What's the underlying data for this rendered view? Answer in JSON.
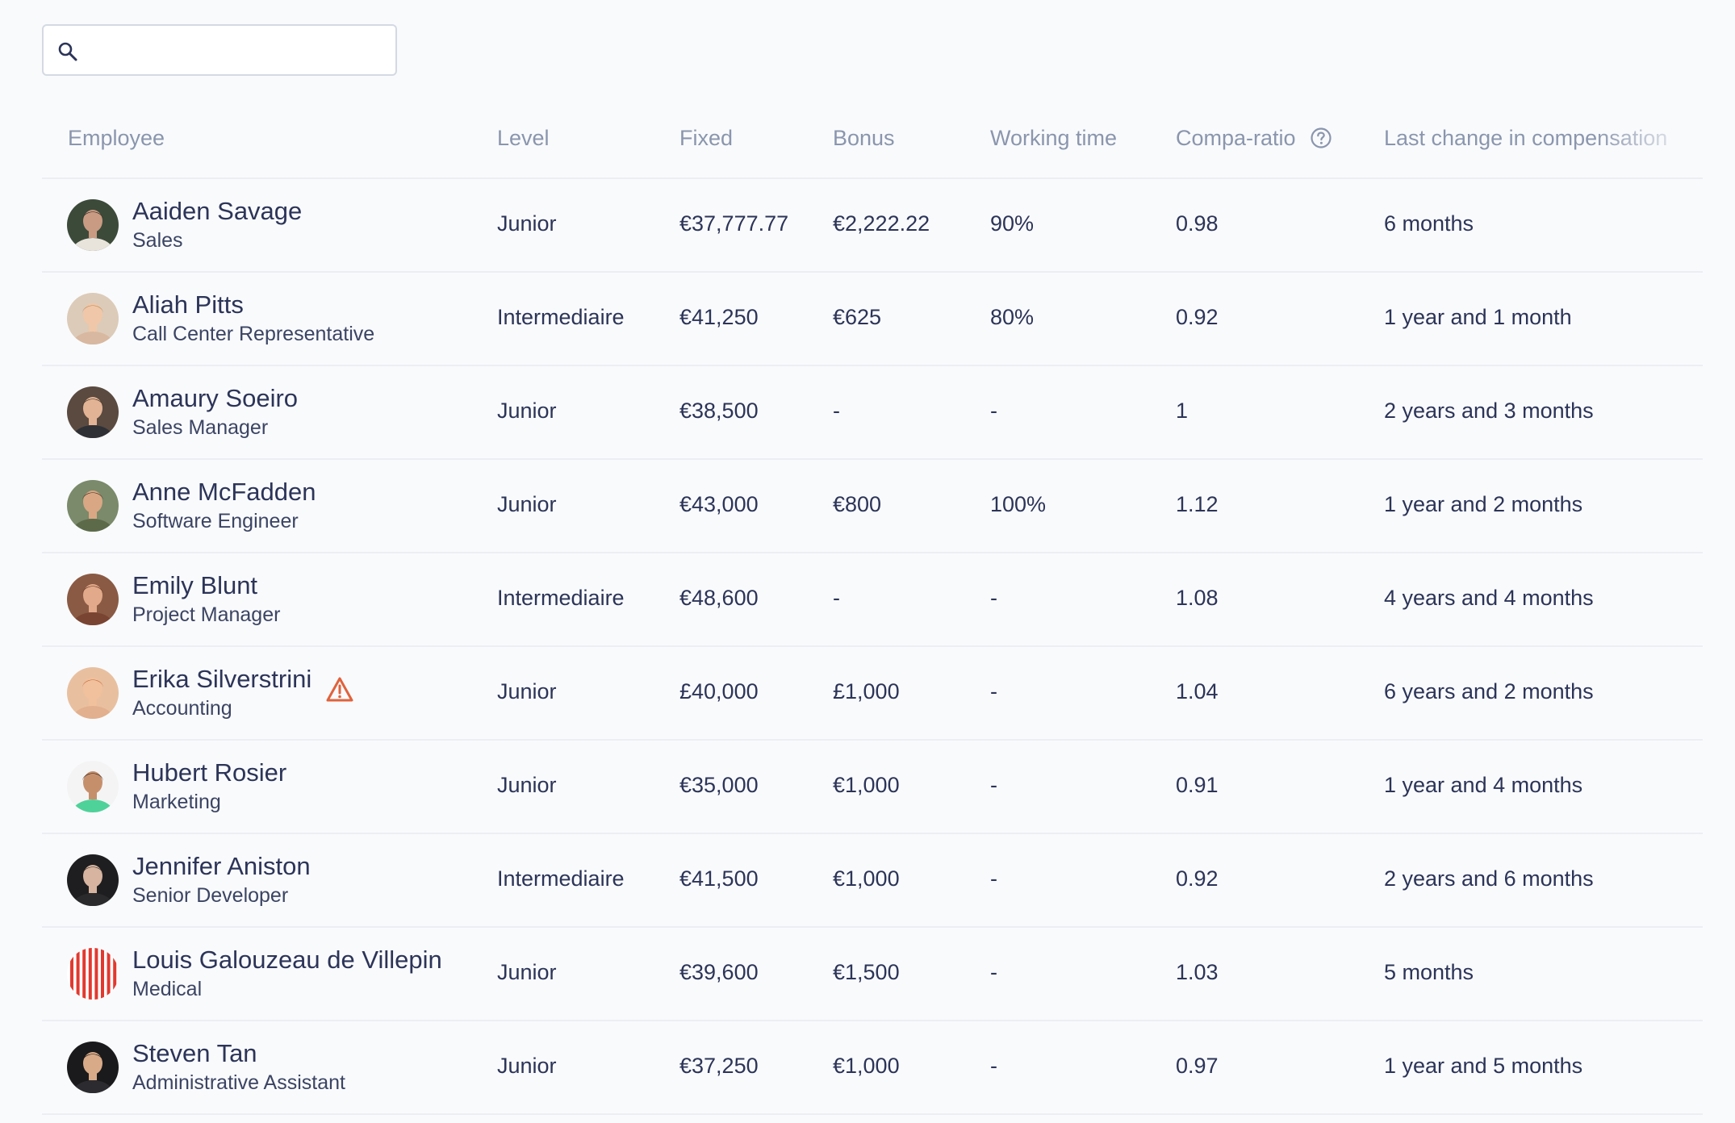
{
  "search": {
    "placeholder": "",
    "value": ""
  },
  "table": {
    "columns": {
      "employee": "Employee",
      "level": "Level",
      "fixed": "Fixed",
      "bonus": "Bonus",
      "working_time": "Working time",
      "compa_ratio": "Compa-ratio",
      "last_change": "Last change in compensation"
    },
    "rows": [
      {
        "name": "Aaiden Savage",
        "role": "Sales",
        "level": "Junior",
        "fixed": "€37,777.77",
        "bonus": "€2,222.22",
        "working_time": "90%",
        "compa_ratio": "0.98",
        "last_change": "6 months",
        "avatar": {
          "bg": "#3c4a3a",
          "face": "#c99b82",
          "hair": "#2a2320",
          "shirt": "#e8e4dc"
        }
      },
      {
        "name": "Aliah Pitts",
        "role": "Call Center Representative",
        "level": "Intermediaire",
        "fixed": "€41,250",
        "bonus": "€625",
        "working_time": "80%",
        "compa_ratio": "0.92",
        "last_change": "1 year and 1 month",
        "avatar": {
          "bg": "#dccbb8",
          "face": "#f0c7a8",
          "hair": "#b98a5a",
          "shirt": "#d8b8a0"
        }
      },
      {
        "name": "Amaury Soeiro",
        "role": "Sales Manager",
        "level": "Junior",
        "fixed": "€38,500",
        "bonus": "-",
        "working_time": "-",
        "compa_ratio": "1",
        "last_change": "2 years and 3 months",
        "avatar": {
          "bg": "#5a4a40",
          "face": "#e2b394",
          "hair": "#3a2a22",
          "shirt": "#2f3036"
        }
      },
      {
        "name": "Anne McFadden",
        "role": "Software Engineer",
        "level": "Junior",
        "fixed": "€43,000",
        "bonus": "€800",
        "working_time": "100%",
        "compa_ratio": "1.12",
        "last_change": "1 year and 2 months",
        "avatar": {
          "bg": "#7a8a6a",
          "face": "#d9a784",
          "hair": "#3b2a1e",
          "shirt": "#5c6a4a"
        }
      },
      {
        "name": "Emily Blunt",
        "role": "Project Manager",
        "level": "Intermediaire",
        "fixed": "€48,600",
        "bonus": "-",
        "working_time": "-",
        "compa_ratio": "1.08",
        "last_change": "4 years and 4 months",
        "avatar": {
          "bg": "#8a5a44",
          "face": "#e2a98a",
          "hair": "#5a2e1c",
          "shirt": "#7a4432"
        }
      },
      {
        "name": "Erika Silverstrini",
        "role": "Accounting",
        "level": "Junior",
        "fixed": "£40,000",
        "bonus": "£1,000",
        "working_time": "-",
        "compa_ratio": "1.04",
        "last_change": "6 years and 2 months",
        "warning": true,
        "warning_color": "#e0623c",
        "avatar": {
          "bg": "#e8c0a0",
          "face": "#f1c09c",
          "hair": "#c46a3a",
          "shirt": "#e2b08e"
        }
      },
      {
        "name": "Hubert Rosier",
        "role": "Marketing",
        "level": "Junior",
        "fixed": "€35,000",
        "bonus": "€1,000",
        "working_time": "-",
        "compa_ratio": "0.91",
        "last_change": "1 year and 4 months",
        "avatar": {
          "bg": "#f4f4f4",
          "face": "#c68f6c",
          "hair": "#2a2018",
          "shirt": "#4fd19a"
        }
      },
      {
        "name": "Jennifer Aniston",
        "role": "Senior Developer",
        "level": "Intermediaire",
        "fixed": "€41,500",
        "bonus": "€1,000",
        "working_time": "-",
        "compa_ratio": "0.92",
        "last_change": "2 years and 6 months",
        "avatar": {
          "bg": "#1e1e20",
          "face": "#d6b4a0",
          "hair": "#3a2e28",
          "shirt": "#2a2a2c"
        }
      },
      {
        "name": "Louis Galouzeau de Villepin",
        "role": "Medical",
        "level": "Junior",
        "fixed": "€39,600",
        "bonus": "€1,500",
        "working_time": "-",
        "compa_ratio": "1.03",
        "last_change": "5 months",
        "stripes": true,
        "avatar": {
          "bg": "#ffffff",
          "stripe": "#e2392f"
        }
      },
      {
        "name": "Steven Tan",
        "role": "Administrative Assistant",
        "level": "Junior",
        "fixed": "€37,250",
        "bonus": "€1,000",
        "working_time": "-",
        "compa_ratio": "0.97",
        "last_change": "1 year and 5 months",
        "avatar": {
          "bg": "#1a1a1c",
          "face": "#d9aa88",
          "hair": "#141414",
          "shirt": "#2c2c30"
        }
      }
    ]
  },
  "icons": {
    "search": "search-icon",
    "help": "help-circle-icon",
    "warning": "warning-icon"
  },
  "colors": {
    "header_text": "#8a96ad",
    "body_text": "#2c3458",
    "divider": "#eceef3",
    "background": "#f9fafc"
  }
}
